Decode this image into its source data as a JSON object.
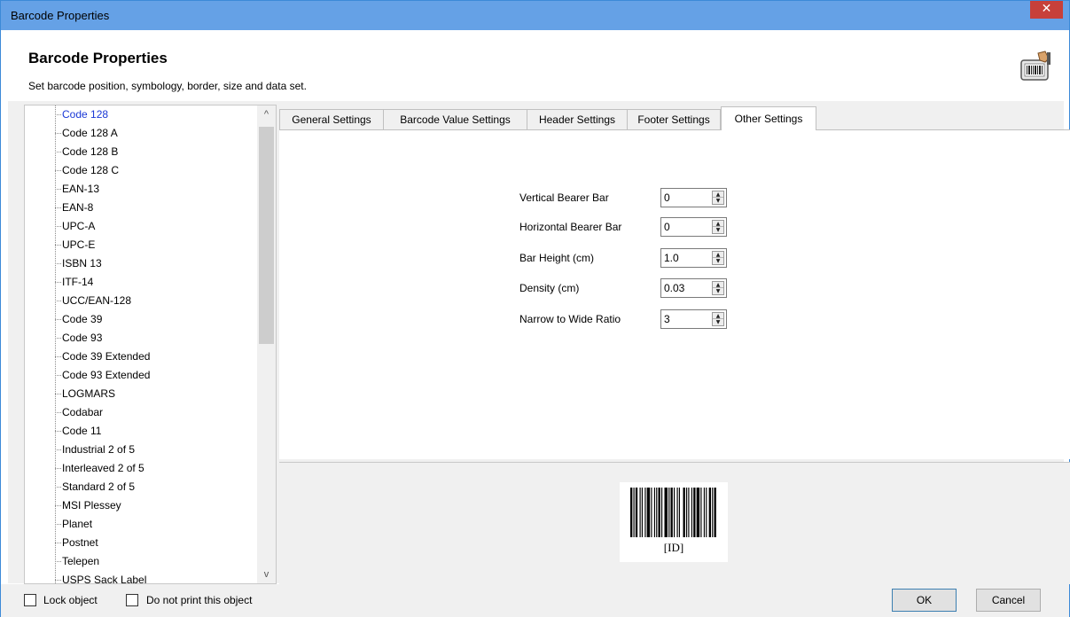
{
  "window": {
    "title": "Barcode Properties",
    "close_glyph": "✕"
  },
  "header": {
    "title": "Barcode Properties",
    "subtitle": "Set barcode position, symbology, border, size and data set.",
    "icon": "barcode-scanner-icon"
  },
  "tree": {
    "items": [
      "Code 128",
      "Code 128 A",
      "Code 128 B",
      "Code 128 C",
      "EAN-13",
      "EAN-8",
      "UPC-A",
      "UPC-E",
      "ISBN 13",
      "ITF-14",
      "UCC/EAN-128",
      "Code 39",
      "Code 93",
      "Code 39 Extended",
      "Code 93 Extended",
      "LOGMARS",
      "Codabar",
      "Code 11",
      "Industrial 2 of 5",
      "Interleaved 2 of 5",
      "Standard 2 of 5",
      "MSI Plessey",
      "Planet",
      "Postnet",
      "Telepen",
      "USPS Sack Label"
    ],
    "selected_index": 0,
    "scroll_up": "^",
    "scroll_down": "v"
  },
  "tabs": [
    {
      "label": "General Settings"
    },
    {
      "label": "Barcode Value Settings"
    },
    {
      "label": "Header Settings"
    },
    {
      "label": "Footer Settings"
    },
    {
      "label": "Other Settings"
    }
  ],
  "active_tab": "Other Settings",
  "other_settings": {
    "fields": [
      {
        "label": "Vertical Bearer Bar",
        "value": "0"
      },
      {
        "label": "Horizontal Bearer Bar",
        "value": "0"
      },
      {
        "label": "Bar Height (cm)",
        "value": "1.0"
      },
      {
        "label": "Density (cm)",
        "value": "0.03"
      },
      {
        "label": "Narrow to Wide Ratio",
        "value": "3"
      }
    ],
    "spin_up": "▲",
    "spin_down": "▼"
  },
  "preview": {
    "barcode_text": "[ID]"
  },
  "footer": {
    "lock_label": "Lock object",
    "no_print_label": "Do not print this object",
    "ok_label": "OK",
    "cancel_label": "Cancel"
  },
  "colors": {
    "titlebar": "#65a1e6",
    "close_button": "#c7403a",
    "selected_tree_item": "#1a38d6"
  }
}
